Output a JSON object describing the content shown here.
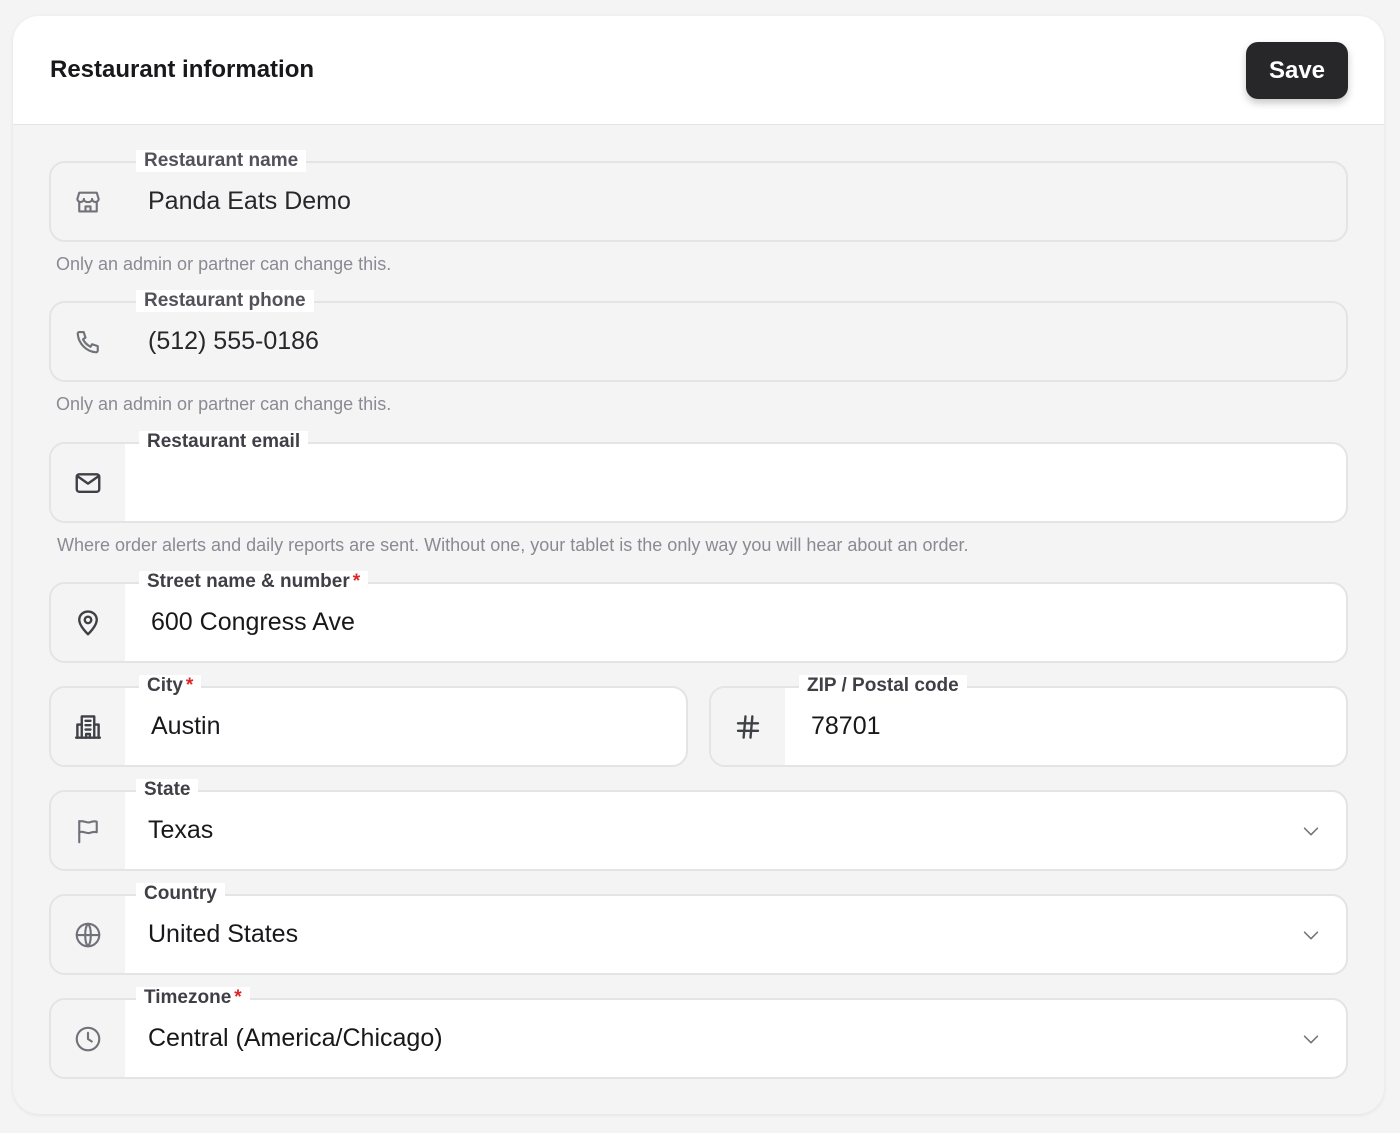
{
  "header": {
    "title": "Restaurant information",
    "save_label": "Save"
  },
  "fields": {
    "name": {
      "label": "Restaurant name",
      "value": "Panda Eats Demo",
      "help": "Only an admin or partner can change this.",
      "icon": "storefront-icon"
    },
    "phone": {
      "label": "Restaurant phone",
      "value": "(512) 555-0186",
      "help": "Only an admin or partner can change this.",
      "icon": "phone-icon"
    },
    "email": {
      "label": "Restaurant email",
      "value": "",
      "help": "Where order alerts and daily reports are sent. Without one, your tablet is the only way you will hear about an order.",
      "icon": "mail-icon"
    },
    "street": {
      "label": "Street name & number",
      "required_mark": "*",
      "value": "600 Congress Ave",
      "icon": "map-pin-icon"
    },
    "city": {
      "label": "City",
      "required_mark": "*",
      "value": "Austin",
      "icon": "building-icon"
    },
    "zip": {
      "label": "ZIP / Postal code",
      "value": "78701",
      "icon": "hash-icon"
    },
    "state": {
      "label": "State",
      "value": "Texas",
      "icon": "flag-icon"
    },
    "country": {
      "label": "Country",
      "value": "United States",
      "icon": "globe-icon"
    },
    "timezone": {
      "label": "Timezone",
      "required_mark": "*",
      "value": "Central (America/Chicago)",
      "icon": "clock-icon"
    }
  },
  "colors": {
    "accent_button": "#27272a",
    "required": "#dc2626",
    "background": "#f4f4f5"
  }
}
